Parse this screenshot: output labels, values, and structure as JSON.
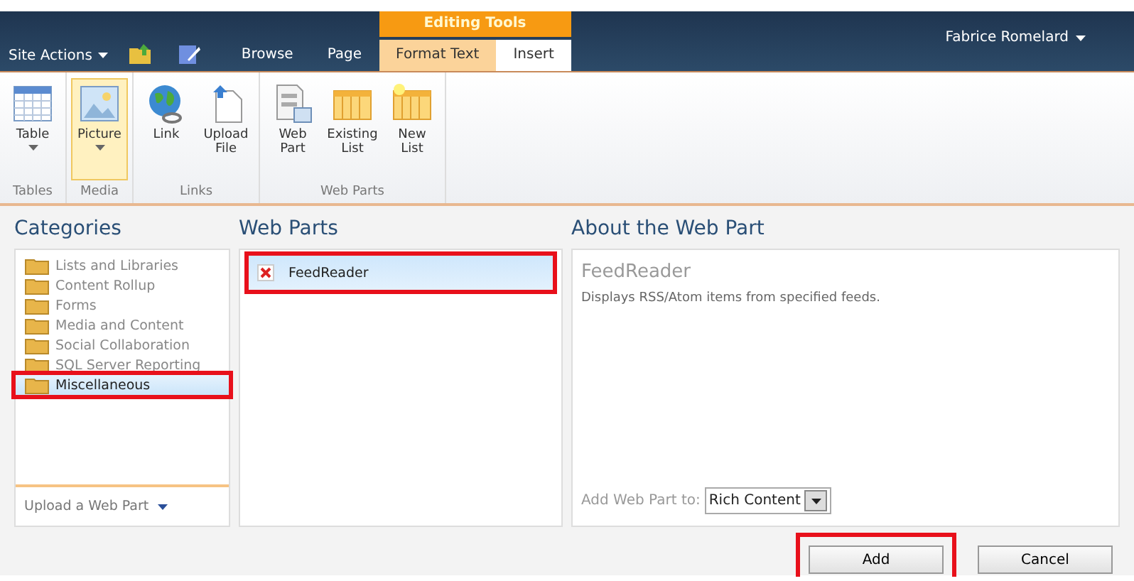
{
  "top_bar": {
    "site_actions": "Site Actions",
    "contextual_group": "Editing Tools",
    "user": "Fabrice Romelard"
  },
  "tabs": [
    {
      "label": "Browse",
      "selected": false,
      "contextual": false
    },
    {
      "label": "Page",
      "selected": false,
      "contextual": false
    },
    {
      "label": "Format Text",
      "selected": false,
      "contextual": true
    },
    {
      "label": "Insert",
      "selected": true,
      "contextual": true
    }
  ],
  "ribbon_groups": [
    {
      "label": "Tables",
      "buttons": [
        {
          "label": "Table",
          "kind": "table",
          "dropdown": true,
          "selected": false
        }
      ]
    },
    {
      "label": "Media",
      "buttons": [
        {
          "label": "Picture",
          "kind": "picture",
          "dropdown": true,
          "selected": true
        }
      ]
    },
    {
      "label": "Links",
      "buttons": [
        {
          "label": "Link",
          "kind": "link",
          "dropdown": false,
          "selected": false
        },
        {
          "label": "Upload File",
          "kind": "upload",
          "dropdown": false,
          "selected": false
        }
      ]
    },
    {
      "label": "Web Parts",
      "buttons": [
        {
          "label": "Web Part",
          "kind": "webpart",
          "dropdown": false,
          "selected": false
        },
        {
          "label": "Existing List",
          "kind": "list",
          "dropdown": false,
          "selected": false
        },
        {
          "label": "New List",
          "kind": "newlist",
          "dropdown": false,
          "selected": false
        }
      ]
    }
  ],
  "categories": {
    "heading": "Categories",
    "items": [
      {
        "label": "Lists and Libraries",
        "selected": false,
        "highlighted": false
      },
      {
        "label": "Content Rollup",
        "selected": false,
        "highlighted": false
      },
      {
        "label": "Forms",
        "selected": false,
        "highlighted": false
      },
      {
        "label": "Media and Content",
        "selected": false,
        "highlighted": false
      },
      {
        "label": "Social Collaboration",
        "selected": false,
        "highlighted": false
      },
      {
        "label": "SQL Server Reporting",
        "selected": false,
        "highlighted": false
      },
      {
        "label": "Miscellaneous",
        "selected": true,
        "highlighted": true
      }
    ],
    "upload_link": "Upload a Web Part"
  },
  "web_parts": {
    "heading": "Web Parts",
    "items": [
      {
        "label": "FeedReader",
        "selected": true,
        "highlighted": true
      }
    ]
  },
  "about": {
    "heading": "About the Web Part",
    "title": "FeedReader",
    "description": "Displays RSS/Atom items from specified feeds.",
    "add_to_label": "Add Web Part to:",
    "add_to_value": "Rich Content"
  },
  "buttons": [
    {
      "label": "Add",
      "highlighted": true
    },
    {
      "label": "Cancel",
      "highlighted": false
    }
  ]
}
